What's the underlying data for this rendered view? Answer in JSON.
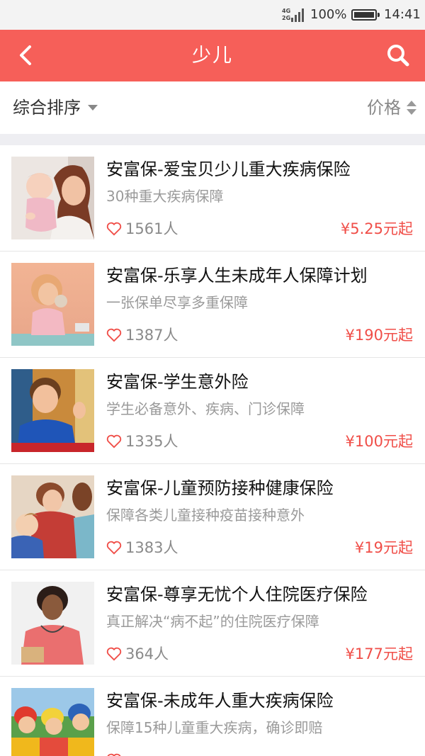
{
  "status_bar": {
    "network_top": "4G",
    "network_bottom": "2G",
    "battery_percent": "100%",
    "battery_level": 1.0,
    "time": "14:41",
    "icons": [
      "signal-icon",
      "battery-icon"
    ]
  },
  "header": {
    "title": "少儿",
    "back_icon": "chevron-left-icon",
    "search_icon": "search-icon",
    "background_color": "#f65f59"
  },
  "filters": {
    "sort_label": "综合排序",
    "price_label": "价格"
  },
  "colors": {
    "accent": "#f65f59",
    "price": "#f04e48",
    "muted_text": "#9a9a9a"
  },
  "products": [
    {
      "title": "安富保-爱宝贝少儿重大疾病保险",
      "desc": "30种重大疾病保障",
      "likes": "1561人",
      "price": "¥5.25元起"
    },
    {
      "title": "安富保-乐享人生未成年人保障计划",
      "desc": "一张保单尽享多重保障",
      "likes": "1387人",
      "price": "¥190元起"
    },
    {
      "title": "安富保-学生意外险",
      "desc": "学生必备意外、疾病、门诊保障",
      "likes": "1335人",
      "price": "¥100元起"
    },
    {
      "title": "安富保-儿童预防接种健康保险",
      "desc": "保障各类儿童接种疫苗接种意外",
      "likes": "1383人",
      "price": "¥19元起"
    },
    {
      "title": "安富保-尊享无忧个人住院医疗保险",
      "desc": "真正解决“病不起”的住院医疗保障",
      "likes": "364人",
      "price": "¥177元起"
    },
    {
      "title": "安富保-未成年人重大疾病保险",
      "desc": "保障15种儿童重大疾病，确诊即赔",
      "likes": "",
      "price": ""
    }
  ]
}
